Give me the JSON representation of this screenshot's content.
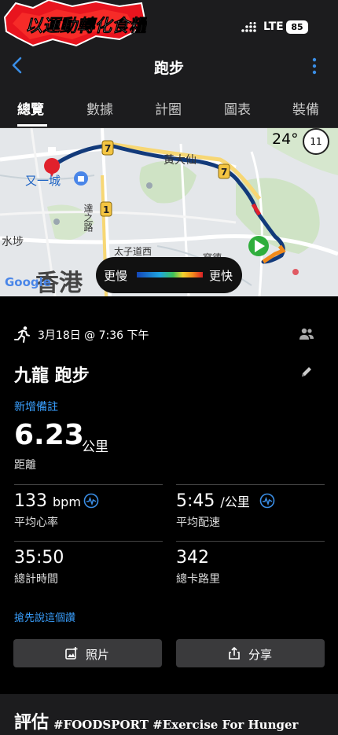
{
  "status_bar": {
    "brand_text": "以運動轉化食糧！",
    "network": "LTE",
    "battery": "85",
    "brand_color": "#e8141e"
  },
  "nav": {
    "title": "跑步",
    "back_icon": "chevron-left-icon",
    "more_icon": "more-vertical-icon",
    "accent": "#3a8ee6"
  },
  "tabs": [
    {
      "label": "總覽",
      "active": true
    },
    {
      "label": "數據",
      "active": false
    },
    {
      "label": "計圈",
      "active": false
    },
    {
      "label": "圖表",
      "active": false
    },
    {
      "label": "裝備",
      "active": false
    }
  ],
  "map": {
    "weather": "24°",
    "wind": "11",
    "labels": [
      "又一城",
      "黃大仙",
      "達之路",
      "水埗",
      "太子道西",
      "香港",
      "窩德"
    ],
    "route_markers": [
      "7",
      "7",
      "1"
    ],
    "legend": {
      "slow": "更慢",
      "fast": "更快"
    },
    "google": "Google"
  },
  "activity": {
    "date": "3月18日 @ 7:36 下午",
    "title": "九龍 跑步",
    "add_note": "新增備註",
    "distance": {
      "value": "6.23",
      "unit": "公里",
      "label": "距離"
    },
    "stats": [
      {
        "value": "133",
        "unit": "bpm",
        "label": "平均心率",
        "has_icon": true
      },
      {
        "value": "5:45",
        "unit": "/公里",
        "label": "平均配速",
        "has_icon": true
      },
      {
        "value": "35:50",
        "unit": "",
        "label": "總計時間",
        "has_icon": false
      },
      {
        "value": "342",
        "unit": "",
        "label": "總卡路里",
        "has_icon": false
      }
    ],
    "first_like": "搶先說這個讚"
  },
  "buttons": {
    "photos": "照片",
    "share": "分享"
  },
  "assessment": {
    "title": "評估",
    "hashtags": "#FOODSPORT #Exercise For Hunger"
  }
}
